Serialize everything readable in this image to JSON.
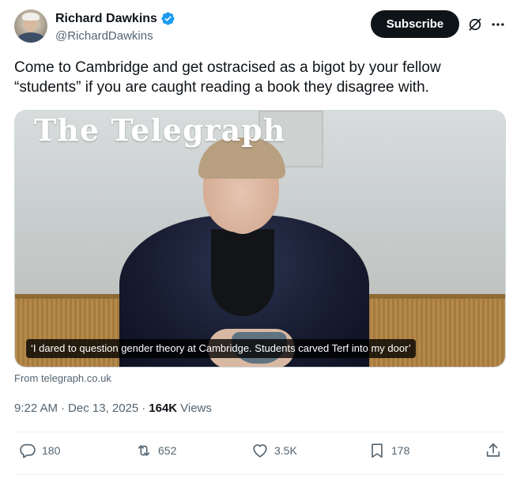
{
  "author": {
    "name": "Richard Dawkins",
    "handle": "@RichardDawkins",
    "verified": true
  },
  "header": {
    "subscribe_label": "Subscribe"
  },
  "tweet": {
    "text": "Come to Cambridge and get ostracised as a bigot by your fellow “students” if you are caught reading a book they disagree with."
  },
  "card": {
    "publisher_logo": "The Telegraph",
    "headline": "‘I dared to question gender theory at Cambridge. Students carved Terf into my door’",
    "source": "From telegraph.co.uk"
  },
  "meta": {
    "time": "9:22 AM",
    "separator": "·",
    "date": "Dec 13, 2025",
    "views_count": "164K",
    "views_label": "Views"
  },
  "actions": {
    "replies": "180",
    "reposts": "652",
    "likes": "3.5K",
    "bookmarks": "178"
  },
  "icons": {
    "verified": "verified-badge-icon",
    "grok": "grok-icon",
    "more": "more-icon",
    "reply": "reply-icon",
    "repost": "repost-icon",
    "like": "heart-icon",
    "bookmark": "bookmark-icon",
    "share": "share-icon"
  },
  "colors": {
    "verified_blue": "#1d9bf0",
    "text_primary": "#0f1419",
    "text_secondary": "#536471",
    "subscribe_bg": "#0f1419"
  }
}
